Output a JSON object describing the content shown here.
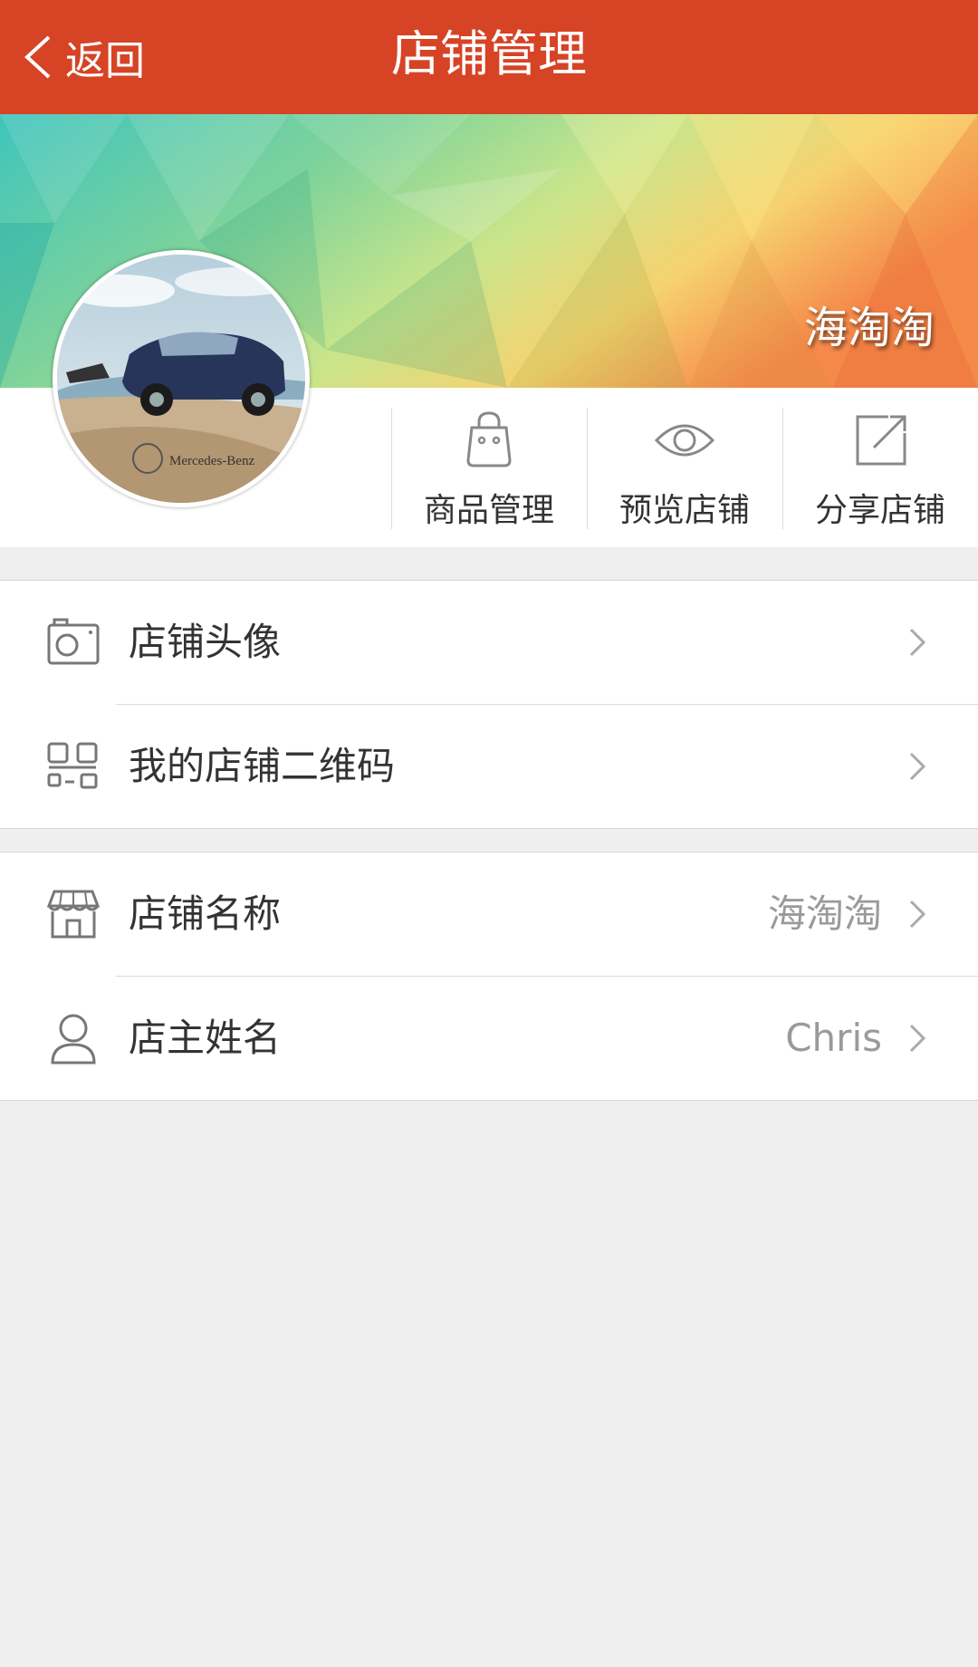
{
  "header": {
    "back_label": "返回",
    "title": "店铺管理",
    "color": "#d64325"
  },
  "banner": {
    "shop_name": "海淘淘",
    "avatar_alt": "Mercedes-Benz"
  },
  "actions": [
    {
      "label": "商品管理",
      "icon": "shopping-bag-icon"
    },
    {
      "label": "预览店铺",
      "icon": "eye-icon"
    },
    {
      "label": "分享店铺",
      "icon": "share-icon"
    }
  ],
  "settings_group_1": [
    {
      "label": "店铺头像",
      "icon": "camera-icon"
    },
    {
      "label": "我的店铺二维码",
      "icon": "qr-code-icon"
    }
  ],
  "settings_group_2": [
    {
      "label": "店铺名称",
      "value": "海淘淘",
      "icon": "storefront-icon"
    },
    {
      "label": "店主姓名",
      "value": "Chris",
      "icon": "user-icon"
    }
  ]
}
